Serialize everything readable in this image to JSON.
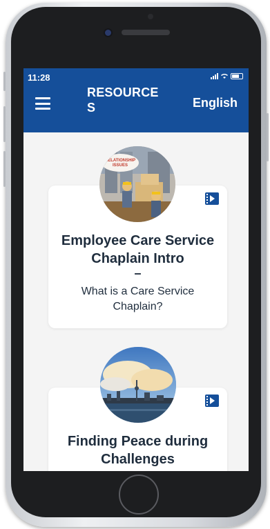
{
  "status_bar": {
    "time": "11:28"
  },
  "header": {
    "title": "RESOURCES",
    "language": "English"
  },
  "cards": [
    {
      "title": "Employee Care Service Chaplain Intro",
      "dash": "–",
      "subtitle": "What is a Care Service Chaplain?",
      "thumb_text": "RELATIONSHIP ISSUES"
    },
    {
      "title": "Finding Peace during Challenges"
    }
  ],
  "colors": {
    "header": "#154f9a",
    "card_text": "#1f2d3d"
  }
}
